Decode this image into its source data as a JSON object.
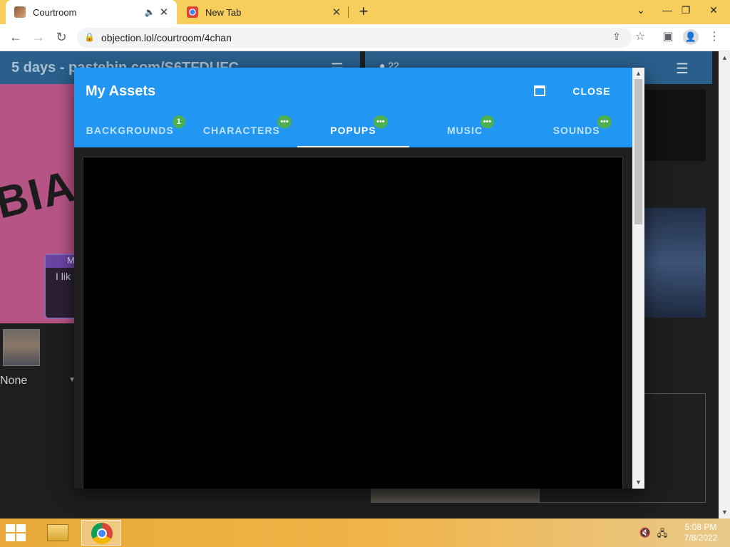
{
  "browser": {
    "tabs": [
      {
        "title": "Courtroom",
        "active": true
      },
      {
        "title": "New Tab",
        "active": false
      }
    ],
    "url": "objection.lol/courtroom/4chan"
  },
  "courtroom": {
    "left_header_title": "5 days - pastebin.com/S6TFDUFC",
    "viewer_count": "22",
    "stage_text": "BIA",
    "textbox_name": "M",
    "textbox_line": "I lik",
    "character_select_value": "None"
  },
  "modal": {
    "title": "My Assets",
    "close_label": "CLOSE",
    "tabs": [
      {
        "label": "BACKGROUNDS",
        "badge": "1",
        "active": false
      },
      {
        "label": "CHARACTERS",
        "badge": "•••",
        "active": false
      },
      {
        "label": "POPUPS",
        "badge": "•••",
        "active": true
      },
      {
        "label": "MUSIC",
        "badge": "•••",
        "active": false
      },
      {
        "label": "SOUNDS",
        "badge": "•••",
        "active": false
      }
    ]
  },
  "taskbar": {
    "time": "5:08 PM",
    "date": "7/8/2022"
  },
  "colors": {
    "browser_frame": "#f7cd5c",
    "modal_header": "#2196f3",
    "badge": "#4caf50",
    "stage_background": "#b75486",
    "app_header": "#2a5f8c"
  },
  "icons": [
    "courtroom-favicon",
    "audio-icon",
    "close-icon",
    "chrome-favicon",
    "plus-icon",
    "chevron-down-icon",
    "minimize-icon",
    "restore-icon",
    "back-icon",
    "forward-icon",
    "reload-icon",
    "lock-icon",
    "share-icon",
    "star-icon",
    "side-panel-icon",
    "profile-icon",
    "kebab-menu-icon",
    "hamburger-icon",
    "user-icon",
    "maximize-icon",
    "windows-start-icon",
    "file-explorer-icon",
    "chrome-icon",
    "volume-muted-icon",
    "network-icon"
  ]
}
